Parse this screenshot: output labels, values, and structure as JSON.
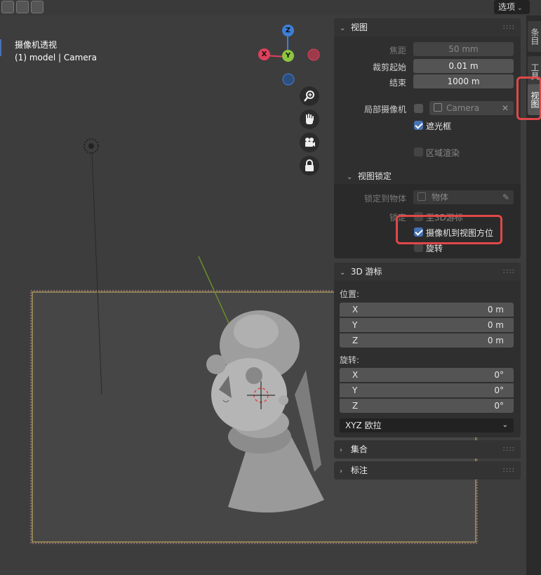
{
  "header": {
    "options_label": "选项"
  },
  "viewport": {
    "title": "摄像机透视",
    "subtitle": "(1) model | Camera"
  },
  "gizmo": {
    "z": "Z",
    "x": "X",
    "y": "Y"
  },
  "view_buttons": [
    "zoom-icon",
    "hand-pan-icon",
    "camera-icon",
    "lock-icon"
  ],
  "panel": {
    "view": {
      "title": "视图",
      "focal_label": "焦距",
      "focal_value": "50 mm",
      "clip_start_label": "裁剪起始",
      "clip_start_value": "0.01 m",
      "clip_end_label": "结束",
      "clip_end_value": "1000 m",
      "local_camera_label": "局部摄像机",
      "local_camera_value": "Camera",
      "passepartout_label": "遮光框",
      "region_render_label": "区域渲染"
    },
    "view_lock": {
      "title": "视图锁定",
      "lock_object_label": "锁定到物体",
      "lock_object_placeholder": "物体",
      "lock_label": "锁定",
      "to_3d_cursor": "至3D游标",
      "camera_to_view": "摄像机到视图方位",
      "rotation": "旋转"
    },
    "cursor": {
      "title": "3D 游标",
      "location_label": "位置:",
      "location": [
        {
          "axis": "X",
          "value": "0 m"
        },
        {
          "axis": "Y",
          "value": "0 m"
        },
        {
          "axis": "Z",
          "value": "0 m"
        }
      ],
      "rotation_label": "旋转:",
      "rotation": [
        {
          "axis": "X",
          "value": "0°"
        },
        {
          "axis": "Y",
          "value": "0°"
        },
        {
          "axis": "Z",
          "value": "0°"
        }
      ],
      "rotation_mode": "XYZ 欧拉"
    },
    "collection": {
      "title": "集合"
    },
    "annotation": {
      "title": "标注"
    }
  },
  "tabs": [
    "条目",
    "工具",
    "视图"
  ],
  "colors": {
    "accent": "#4772b3",
    "highlight": "#e04848",
    "x_axis": "#e0405a",
    "y_axis": "#8cc63f",
    "z_axis": "#3d7fd6"
  }
}
